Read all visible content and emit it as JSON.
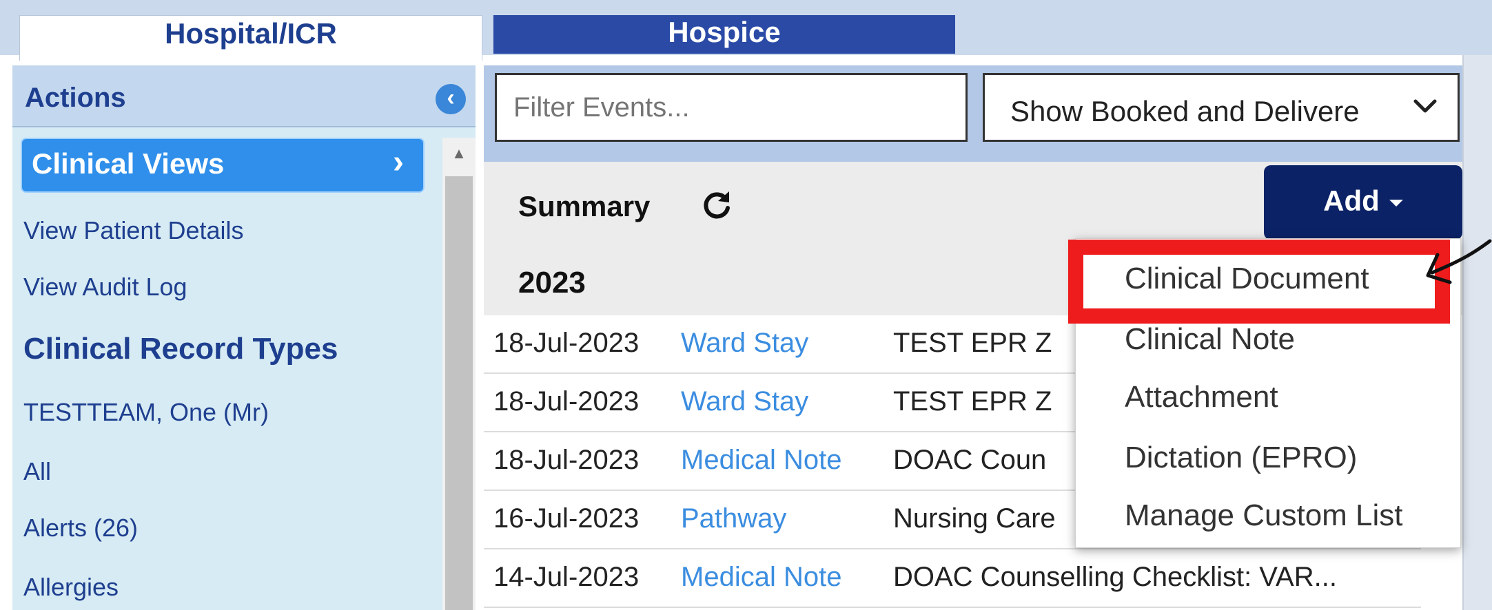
{
  "tabs": {
    "hospital": "Hospital/ICR",
    "hospice": "Hospice"
  },
  "sidebar": {
    "header": "Actions",
    "collapse_icon": "chevron-left-circle-icon",
    "active_item": "Clinical Views",
    "links": [
      "View Patient Details",
      "View Audit Log"
    ],
    "section_heading": "Clinical Record Types",
    "record_items": [
      "TESTTEAM, One (Mr)",
      "All",
      "Alerts (26)",
      "Allergies"
    ]
  },
  "filter": {
    "placeholder": "Filter Events...",
    "show_select": "Show Booked and Delivere"
  },
  "summary": {
    "title": "Summary",
    "refresh_icon": "refresh-icon",
    "add_label": "Add",
    "year": "2023"
  },
  "events": [
    {
      "date": "18-Jul-2023",
      "type": "Ward Stay",
      "desc": "TEST EPR Z"
    },
    {
      "date": "18-Jul-2023",
      "type": "Ward Stay",
      "desc": "TEST EPR Z"
    },
    {
      "date": "18-Jul-2023",
      "type": "Medical Note",
      "desc": "DOAC Coun"
    },
    {
      "date": "16-Jul-2023",
      "type": "Pathway",
      "desc": "Nursing Care"
    },
    {
      "date": "14-Jul-2023",
      "type": "Medical Note",
      "desc": "DOAC Counselling Checklist: VAR..."
    }
  ],
  "add_menu": [
    "Clinical Document",
    "Clinical Note",
    "Attachment",
    "Dictation (EPRO)",
    "Manage Custom List"
  ],
  "colors": {
    "highlight": "#ee1c1c",
    "add_button": "#0b2267",
    "link_blue": "#3b8de0",
    "hospice_tab": "#2a4aa6"
  }
}
